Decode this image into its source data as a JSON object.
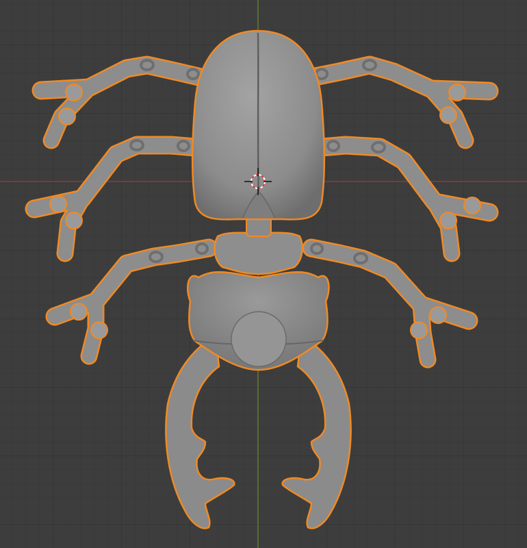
{
  "viewport": {
    "background": "#3d3d3d",
    "grid_minor_color": "#373737",
    "grid_major_color": "#333333",
    "x_axis_color": "#a83a3a",
    "y_axis_color": "#6d8a2e"
  },
  "object": {
    "selected": true,
    "selection_outline_color": "#f08a24",
    "clay_color": "#8a8a8a"
  },
  "cursor": {
    "icon": "3d-cursor-icon",
    "ring_colors": [
      "#e23b3b",
      "#ffffff"
    ]
  }
}
